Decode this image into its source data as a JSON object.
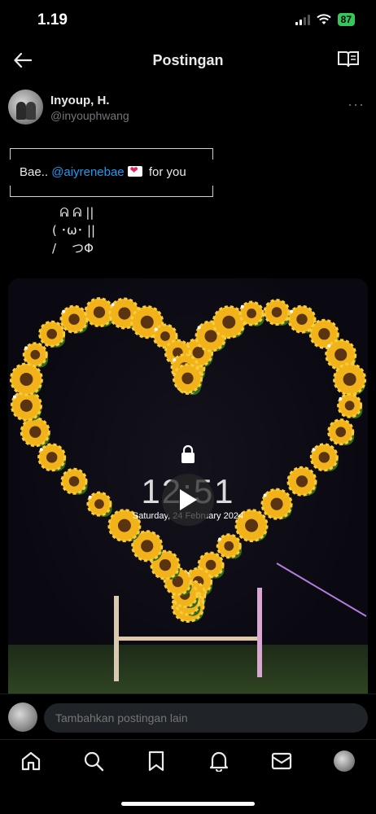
{
  "status_bar": {
    "time": "1.19",
    "battery": "87"
  },
  "header": {
    "title": "Postingan",
    "back_icon": "arrow-left-icon",
    "reader_icon": "book-open-icon"
  },
  "post": {
    "author_name": "Inyoup, H.",
    "author_handle": "@inyouphwang",
    "text_prefix": "Bae.. ",
    "mention": "@aiyrenebae",
    "text_suffix": " for you",
    "bunny_line1": "  ᕱ ᕱ ||",
    "bunny_line2": "( ･ω･ ||",
    "bunny_line3": "/    つΦ"
  },
  "media": {
    "lock_time": "12:51",
    "lock_date": "Saturday, 24 February 2024"
  },
  "reply": {
    "placeholder": "Tambahkan postingan lain"
  },
  "nav": {
    "items": [
      "home-icon",
      "search-icon",
      "bookmark-icon",
      "bell-icon",
      "mail-icon",
      "profile-avatar"
    ]
  },
  "colors": {
    "background": "#000000",
    "accent": "#1d9bf0",
    "muted": "#71767b",
    "battery": "#34c759"
  }
}
